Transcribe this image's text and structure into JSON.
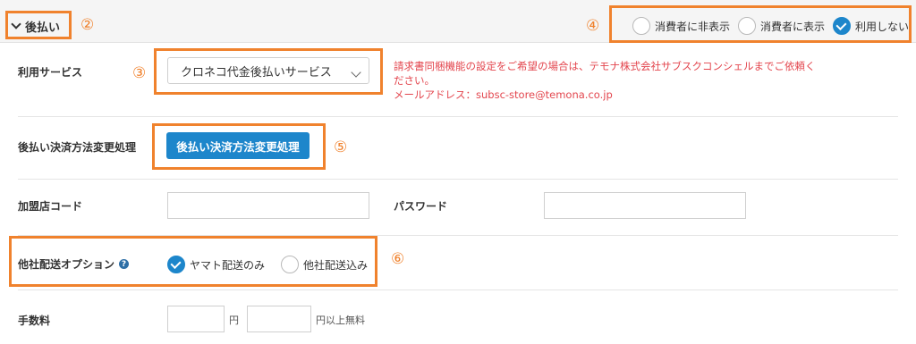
{
  "section": {
    "toggle_label": "後払い",
    "toggle_icon": "chevron-down-icon",
    "display_options": [
      {
        "label": "消費者に非表示",
        "checked": false
      },
      {
        "label": "消費者に表示",
        "checked": false
      },
      {
        "label": "利用しない",
        "checked": true
      }
    ]
  },
  "callouts": {
    "c2": "②",
    "c3": "③",
    "c4": "④",
    "c5": "⑤",
    "c6": "⑥"
  },
  "service": {
    "label": "利用サービス",
    "selected": "クロネコ代金後払いサービス",
    "notice_line1": "請求書同梱機能の設定をご希望の場合は、テモナ株式会社サブスクコンシェルまでご依頼く",
    "notice_line2": "ださい。",
    "notice_line3": "メールアドレス：subsc-store@temona.co.jp"
  },
  "method_change": {
    "label": "後払い決済方法変更処理",
    "button_label": "後払い決済方法変更処理"
  },
  "merchant": {
    "code_label": "加盟店コード",
    "code_value": "",
    "password_label": "パスワード",
    "password_value": ""
  },
  "shipping_option": {
    "label": "他社配送オプション",
    "help_icon": "question-circle-icon",
    "options": [
      {
        "label": "ヤマト配送のみ",
        "checked": true
      },
      {
        "label": "他社配送込み",
        "checked": false
      }
    ]
  },
  "fee": {
    "label": "手数料",
    "amount_value": "",
    "unit": "円",
    "free_threshold_value": "",
    "free_unit": "円以上無料"
  },
  "colors": {
    "accent": "#1d86cb",
    "highlight": "#f0822d",
    "notice": "#e3464e"
  }
}
